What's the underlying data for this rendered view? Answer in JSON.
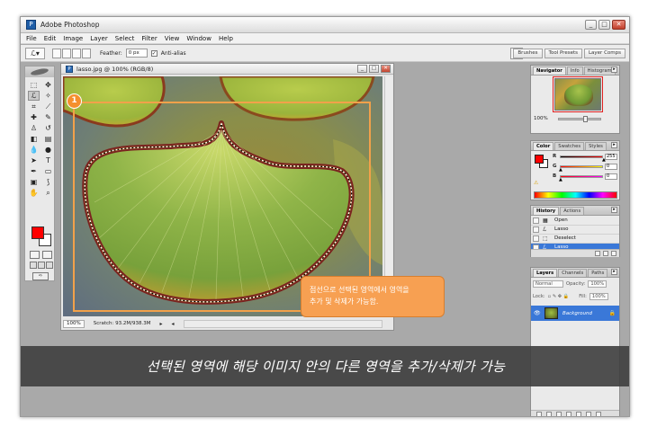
{
  "window": {
    "title": "Adobe Photoshop",
    "buttons": [
      "_",
      "□",
      "✕"
    ]
  },
  "menubar": {
    "items": [
      "File",
      "Edit",
      "Image",
      "Layer",
      "Select",
      "Filter",
      "View",
      "Window",
      "Help"
    ]
  },
  "options_bar": {
    "feather_label": "Feather:",
    "feather_value": "0 px",
    "antialias_label": "Anti-alias",
    "wells": [
      "Brushes",
      "Tool Presets",
      "Layer Comps"
    ]
  },
  "document": {
    "title": "lasso.jpg @ 100% (RGB/8)",
    "zoom": "100%",
    "scratch": "Scratch: 93.2M/938.3M"
  },
  "navigator": {
    "tabs": [
      "Navigator",
      "Info",
      "Histogram"
    ],
    "zoom": "100%"
  },
  "color_panel": {
    "tabs": [
      "Color",
      "Swatches",
      "Styles"
    ],
    "channels": [
      {
        "label": "R",
        "value": "255"
      },
      {
        "label": "G",
        "value": "0"
      },
      {
        "label": "B",
        "value": "0"
      }
    ],
    "colors": {
      "foreground": "#ff0000",
      "background": "#ffffff"
    }
  },
  "history_panel": {
    "tabs": [
      "History",
      "Actions"
    ],
    "items": [
      "Open",
      "Lasso",
      "Deselect",
      "Lasso"
    ],
    "selected_index": 3
  },
  "layers_panel": {
    "tabs": [
      "Layers",
      "Channels",
      "Paths"
    ],
    "blend_mode": "Normal",
    "opacity_label": "Opacity:",
    "opacity_value": "100%",
    "lock_label": "Lock:",
    "fill_label": "Fill:",
    "fill_value": "100%",
    "layer_name": "Background"
  },
  "annotations": {
    "marker_number": "1",
    "callout_line1": "점선으로 선택된 영역에서 영역을",
    "callout_line2": "추가 및 삭제가 가능함.",
    "caption": "선택된 영역에 해당 이미지 안의 다른 영역을 추가/삭제가 가능",
    "accent_color": "#f2a14a"
  }
}
